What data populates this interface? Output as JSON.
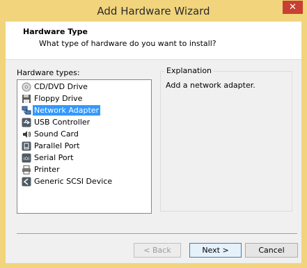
{
  "window": {
    "title": "Add Hardware Wizard",
    "close_glyph": "✕"
  },
  "header": {
    "title": "Hardware Type",
    "subtitle": "What type of hardware do you want to install?"
  },
  "hardware_types": {
    "label": "Hardware types:",
    "selected_index": 2,
    "items": [
      {
        "label": "CD/DVD Drive",
        "icon": "cd-dvd-icon"
      },
      {
        "label": "Floppy Drive",
        "icon": "floppy-icon"
      },
      {
        "label": "Network Adapter",
        "icon": "network-adapter-icon"
      },
      {
        "label": "USB Controller",
        "icon": "usb-icon"
      },
      {
        "label": "Sound Card",
        "icon": "sound-card-icon"
      },
      {
        "label": "Parallel Port",
        "icon": "parallel-port-icon"
      },
      {
        "label": "Serial Port",
        "icon": "serial-port-icon"
      },
      {
        "label": "Printer",
        "icon": "printer-icon"
      },
      {
        "label": "Generic SCSI Device",
        "icon": "scsi-icon"
      }
    ]
  },
  "explanation": {
    "label": "Explanation",
    "text": "Add a network adapter."
  },
  "buttons": {
    "back": "< Back",
    "next": "Next >",
    "cancel": "Cancel"
  },
  "colors": {
    "titlebar": "#f1d47c",
    "selection": "#3399ff",
    "close_button": "#c74032"
  }
}
